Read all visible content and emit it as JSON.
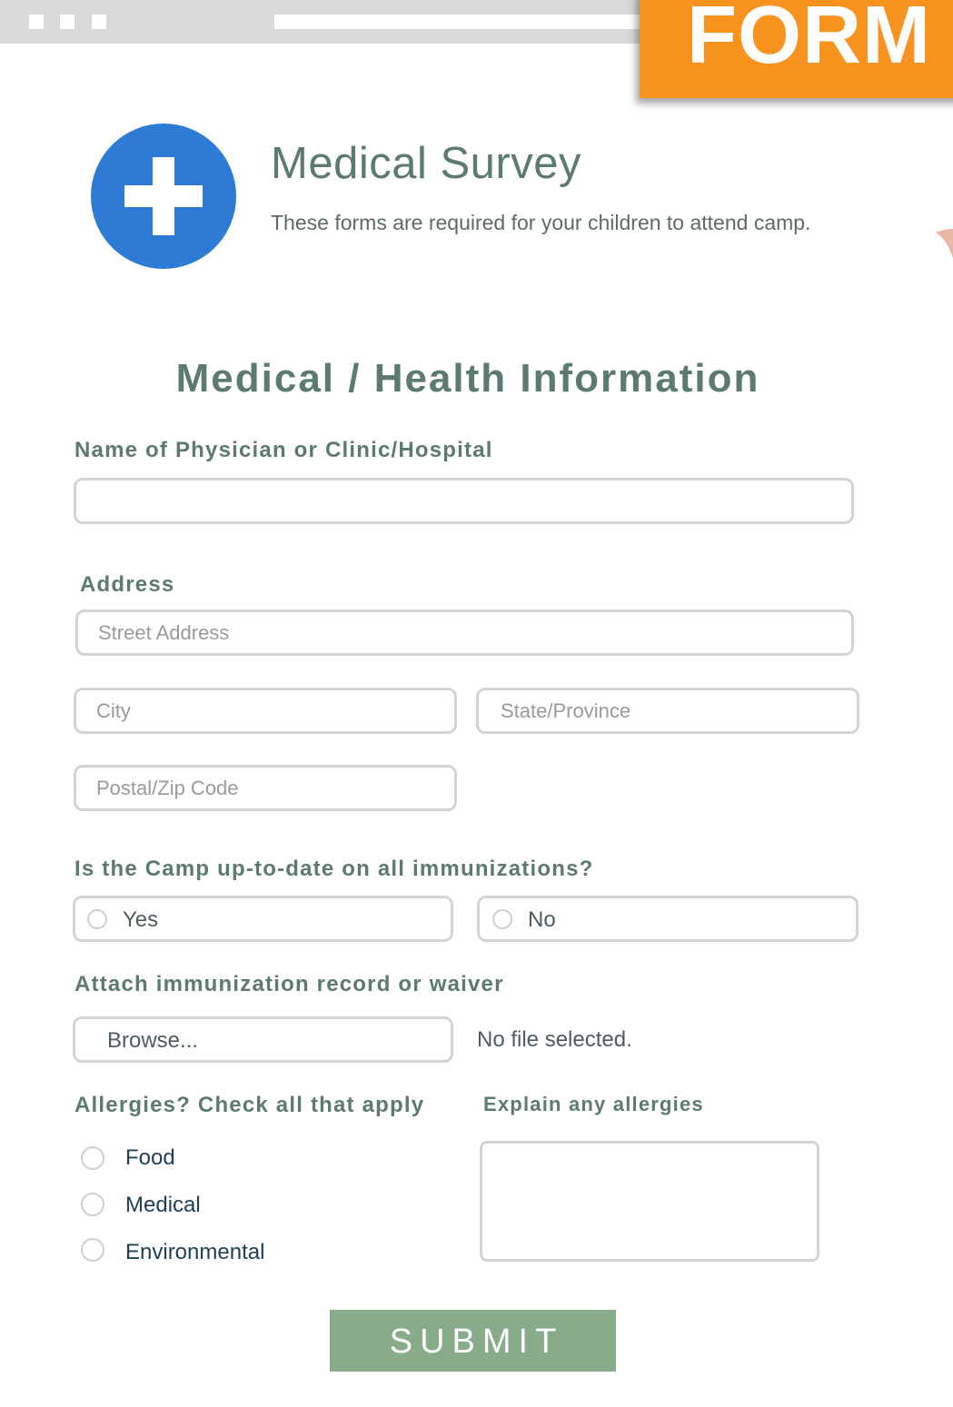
{
  "banner": {
    "label": "FORM",
    "color": "#f7931e"
  },
  "header": {
    "icon": "medical-cross-icon",
    "title": "Medical Survey",
    "subtitle": "These forms are required for your children to attend camp."
  },
  "section": {
    "title": "Medical / Health Information"
  },
  "physician": {
    "label": "Name of Physician or Clinic/Hospital",
    "value": ""
  },
  "address": {
    "label": "Address",
    "street_placeholder": "Street Address",
    "city_placeholder": "City",
    "state_placeholder": "State/Province",
    "zip_placeholder": "Postal/Zip Code"
  },
  "immunization": {
    "question": "Is the Camp up-to-date on all immunizations?",
    "options": [
      "Yes",
      "No"
    ]
  },
  "attachment": {
    "label": "Attach immunization record or waiver",
    "browse_label": "Browse...",
    "status": "No file selected."
  },
  "allergies": {
    "label": "Allergies? Check all that apply",
    "options": [
      "Food",
      "Medical",
      "Environmental"
    ],
    "explain_label": "Explain any allergies",
    "explain_value": ""
  },
  "submit": {
    "label": "SUBMIT",
    "color": "#88ab8a"
  },
  "colors": {
    "heading": "#5c7a6e",
    "accent_blue": "#2e7bd6",
    "field_border": "#d4d4d4"
  }
}
